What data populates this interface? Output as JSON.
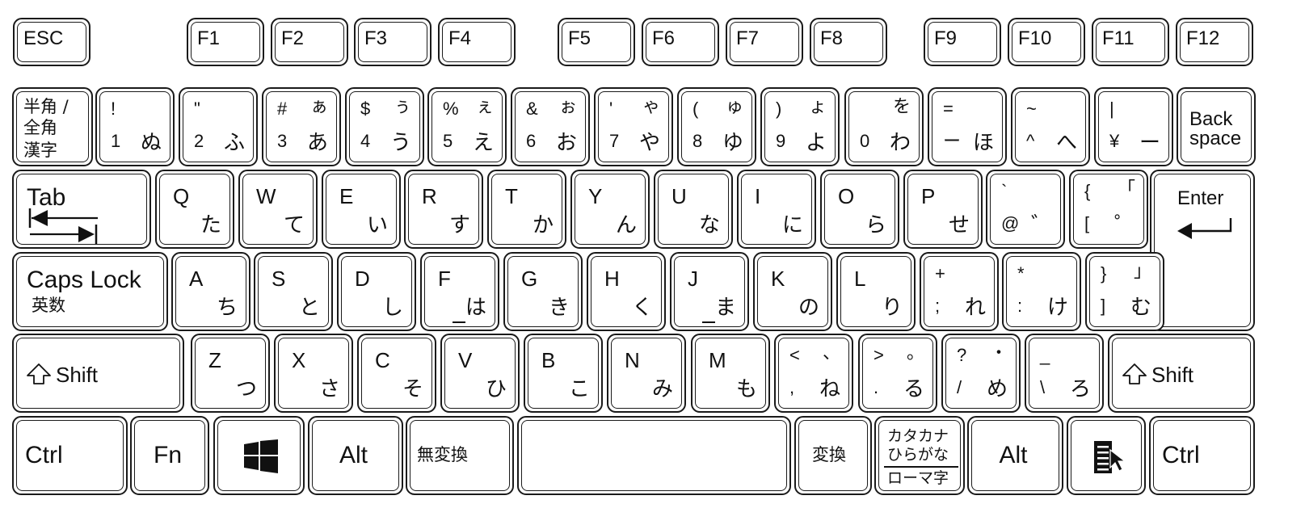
{
  "keyboard": {
    "fn_row": [
      {
        "id": "esc",
        "label": "ESC"
      },
      {
        "id": "f1",
        "label": "F1"
      },
      {
        "id": "f2",
        "label": "F2"
      },
      {
        "id": "f3",
        "label": "F3"
      },
      {
        "id": "f4",
        "label": "F4"
      },
      {
        "id": "f5",
        "label": "F5"
      },
      {
        "id": "f6",
        "label": "F6"
      },
      {
        "id": "f7",
        "label": "F7"
      },
      {
        "id": "f8",
        "label": "F8"
      },
      {
        "id": "f9",
        "label": "F9"
      },
      {
        "id": "f10",
        "label": "F10"
      },
      {
        "id": "f11",
        "label": "F11"
      },
      {
        "id": "f12",
        "label": "F12"
      }
    ],
    "number_row": [
      {
        "id": "hankaku",
        "lines": [
          "半角 /",
          "全角",
          "漢字"
        ]
      },
      {
        "id": "1",
        "shift": "!",
        "kana_shift": "",
        "main": "1",
        "kana": "ぬ"
      },
      {
        "id": "2",
        "shift": "\"",
        "kana_shift": "",
        "main": "2",
        "kana": "ふ"
      },
      {
        "id": "3",
        "shift": "#",
        "kana_shift": "ぁ",
        "main": "3",
        "kana": "あ"
      },
      {
        "id": "4",
        "shift": "$",
        "kana_shift": "ぅ",
        "main": "4",
        "kana": "う"
      },
      {
        "id": "5",
        "shift": "%",
        "kana_shift": "ぇ",
        "main": "5",
        "kana": "え"
      },
      {
        "id": "6",
        "shift": "&",
        "kana_shift": "ぉ",
        "main": "6",
        "kana": "お"
      },
      {
        "id": "7",
        "shift": "'",
        "kana_shift": "ゃ",
        "main": "7",
        "kana": "や"
      },
      {
        "id": "8",
        "shift": "(",
        "kana_shift": "ゅ",
        "main": "8",
        "kana": "ゆ"
      },
      {
        "id": "9",
        "shift": ")",
        "kana_shift": "ょ",
        "main": "9",
        "kana": "よ"
      },
      {
        "id": "0",
        "shift": "",
        "kana_shift": "を",
        "main": "0",
        "kana": "わ"
      },
      {
        "id": "minus",
        "shift": "=",
        "kana_shift": "",
        "main": "ー",
        "kana": "ほ"
      },
      {
        "id": "caret",
        "shift": "~",
        "kana_shift": "",
        "main": "^",
        "kana": "へ"
      },
      {
        "id": "yen",
        "shift": "|",
        "kana_shift": "",
        "main": "¥",
        "kana": "ー"
      },
      {
        "id": "backspace",
        "lines": [
          "Back",
          "space"
        ]
      }
    ],
    "tab_row": [
      {
        "id": "tab",
        "label": "Tab"
      },
      {
        "id": "q",
        "main": "Q",
        "kana": "た"
      },
      {
        "id": "w",
        "main": "W",
        "kana": "て"
      },
      {
        "id": "e",
        "main": "E",
        "kana": "い"
      },
      {
        "id": "r",
        "main": "R",
        "kana": "す"
      },
      {
        "id": "t",
        "main": "T",
        "kana": "か"
      },
      {
        "id": "y",
        "main": "Y",
        "kana": "ん"
      },
      {
        "id": "u",
        "main": "U",
        "kana": "な"
      },
      {
        "id": "i",
        "main": "I",
        "kana": "に"
      },
      {
        "id": "o",
        "main": "O",
        "kana": "ら"
      },
      {
        "id": "p",
        "main": "P",
        "kana": "せ"
      },
      {
        "id": "at",
        "shift": "`",
        "kana_shift": "",
        "main": "@",
        "kana": "゛"
      },
      {
        "id": "bracket",
        "shift": "{",
        "kana_shift": "「",
        "main": "[",
        "kana": "゜"
      },
      {
        "id": "enter",
        "label": "Enter"
      }
    ],
    "caps_row": [
      {
        "id": "caps",
        "label": "Caps Lock",
        "sub": "英数"
      },
      {
        "id": "a",
        "main": "A",
        "kana": "ち"
      },
      {
        "id": "s",
        "main": "S",
        "kana": "と"
      },
      {
        "id": "d",
        "main": "D",
        "kana": "し"
      },
      {
        "id": "f",
        "main": "F",
        "kana": "は"
      },
      {
        "id": "g",
        "main": "G",
        "kana": "き"
      },
      {
        "id": "h",
        "main": "H",
        "kana": "く"
      },
      {
        "id": "j",
        "main": "J",
        "kana": "ま"
      },
      {
        "id": "k",
        "main": "K",
        "kana": "の"
      },
      {
        "id": "l",
        "main": "L",
        "kana": "り"
      },
      {
        "id": "semicolon",
        "shift": "+",
        "kana_shift": "",
        "main": ";",
        "kana": "れ"
      },
      {
        "id": "colon",
        "shift": "*",
        "kana_shift": "",
        "main": ":",
        "kana": "け"
      },
      {
        "id": "rbracket",
        "shift": "}",
        "kana_shift": "」",
        "main": "]",
        "kana": "む"
      }
    ],
    "shift_row": [
      {
        "id": "lshift",
        "label": "Shift"
      },
      {
        "id": "z",
        "main": "Z",
        "kana": "つ"
      },
      {
        "id": "x",
        "main": "X",
        "kana": "さ"
      },
      {
        "id": "c",
        "main": "C",
        "kana": "そ"
      },
      {
        "id": "v",
        "main": "V",
        "kana": "ひ"
      },
      {
        "id": "b",
        "main": "B",
        "kana": "こ"
      },
      {
        "id": "n",
        "main": "N",
        "kana": "み"
      },
      {
        "id": "m",
        "main": "M",
        "kana": "も"
      },
      {
        "id": "comma",
        "shift": "<",
        "kana_shift": "、",
        "main": ",",
        "kana": "ね"
      },
      {
        "id": "period",
        "shift": ">",
        "kana_shift": "。",
        "main": ".",
        "kana": "る"
      },
      {
        "id": "slash",
        "shift": "?",
        "kana_shift": "・",
        "main": "/",
        "kana": "め"
      },
      {
        "id": "backslash",
        "shift": "_",
        "kana_shift": "",
        "main": "\\",
        "kana": "ろ"
      },
      {
        "id": "rshift",
        "label": "Shift"
      }
    ],
    "bottom_row": [
      {
        "id": "lctrl",
        "label": "Ctrl"
      },
      {
        "id": "fn",
        "label": "Fn"
      },
      {
        "id": "win",
        "label": "",
        "icon": "windows-logo-icon"
      },
      {
        "id": "lalt",
        "label": "Alt"
      },
      {
        "id": "muhenkan",
        "label": "無変換"
      },
      {
        "id": "space",
        "label": ""
      },
      {
        "id": "henkan",
        "label": "変換"
      },
      {
        "id": "kana",
        "lines": [
          "カタカナ",
          "ひらがな",
          "ローマ字"
        ]
      },
      {
        "id": "ralt",
        "label": "Alt"
      },
      {
        "id": "menu",
        "label": "",
        "icon": "context-menu-icon"
      },
      {
        "id": "rctrl",
        "label": "Ctrl"
      }
    ]
  }
}
